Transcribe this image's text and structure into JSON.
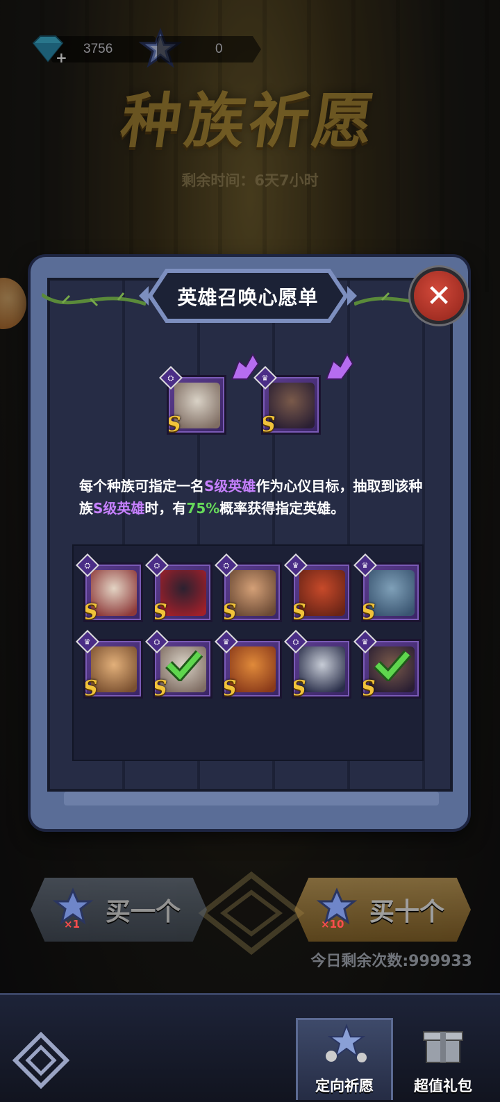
{
  "currency": {
    "gems": "3756",
    "stars": "0"
  },
  "title": "种族祈愿",
  "time_left": "剩余时间：6天7小时",
  "modal": {
    "header": "英雄召唤心愿单",
    "close_icon": "close-x",
    "selected": [
      {
        "hero": "old-scientist",
        "rank": "S",
        "race": "human",
        "portrait": [
          "#d9d2c6",
          "#7f6d63"
        ]
      },
      {
        "hero": "ufo-warrior",
        "rank": "S",
        "race": "monster",
        "portrait": [
          "#7a5a4a",
          "#2a1f33"
        ]
      }
    ],
    "description": {
      "p1": "每个种族可指定一名",
      "p2": "S级英雄",
      "p3": "作为心仪目标，抽取到该种族",
      "p4": "S级英雄",
      "p5": "时，有",
      "p6": "75%",
      "p7": "概率获得指定英雄。"
    },
    "heroes": [
      {
        "name": "white-lady",
        "rank": "S",
        "race": "human",
        "checked": false,
        "portrait": [
          "#e3d4c4",
          "#8e3a3a"
        ]
      },
      {
        "name": "masked-ninja",
        "rank": "S",
        "race": "human",
        "checked": false,
        "portrait": [
          "#2b2130",
          "#a0202a"
        ]
      },
      {
        "name": "bald-monk",
        "rank": "S",
        "race": "human",
        "checked": false,
        "portrait": [
          "#d4a077",
          "#6b4a35"
        ]
      },
      {
        "name": "red-beast",
        "rank": "S",
        "race": "monster",
        "checked": false,
        "portrait": [
          "#c74a2a",
          "#6a2416"
        ]
      },
      {
        "name": "blue-dragon",
        "rank": "S",
        "race": "monster",
        "checked": false,
        "portrait": [
          "#7fa0b8",
          "#3a5571"
        ]
      },
      {
        "name": "tiger-warrior",
        "rank": "S",
        "race": "monster",
        "checked": false,
        "portrait": [
          "#e2b07a",
          "#7a5030"
        ]
      },
      {
        "name": "old-scientist",
        "rank": "S",
        "race": "human",
        "checked": true,
        "portrait": [
          "#d9d2c6",
          "#7f6d63"
        ]
      },
      {
        "name": "fire-lion",
        "rank": "S",
        "race": "monster",
        "checked": false,
        "portrait": [
          "#e08a3a",
          "#8a3a1a"
        ]
      },
      {
        "name": "silver-vampire",
        "rank": "S",
        "race": "human",
        "checked": false,
        "portrait": [
          "#c7ccd6",
          "#2a2f4a"
        ]
      },
      {
        "name": "ufo-warrior",
        "rank": "S",
        "race": "monster",
        "checked": true,
        "portrait": [
          "#7a5a4a",
          "#2a1f33"
        ]
      }
    ]
  },
  "buy": {
    "one_label": "买一个",
    "one_mult": "×1",
    "ten_label": "买十个",
    "ten_mult": "×10",
    "remaining": "今日剩余次数:999933"
  },
  "nav": {
    "tab_wish": "定向祈愿",
    "tab_gift": "超值礼包"
  },
  "colors": {
    "accent_purple": "#c781ff",
    "accent_green": "#66d95a",
    "rank_gold": "#f1c33a",
    "close_red": "#c63a2c"
  }
}
